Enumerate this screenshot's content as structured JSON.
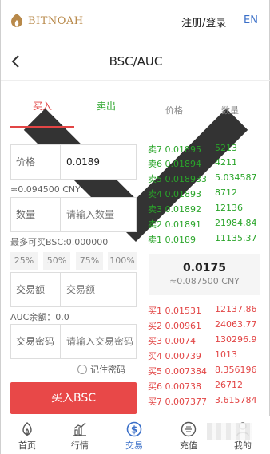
{
  "header": {
    "brand": "BITNOAH",
    "login": "注册/登录",
    "lang": "EN"
  },
  "titlebar": {
    "title": "BSC/AUC"
  },
  "tabs": {
    "buy": "买入",
    "sell": "卖出"
  },
  "form": {
    "price_label": "价格",
    "price_value": "0.0189",
    "price_cny": "≈0.094500 CNY",
    "qty_label": "数量",
    "qty_placeholder": "请输入数量",
    "max_buy": "最多可买BSC:0.000000",
    "percents": [
      "25%",
      "50%",
      "75%",
      "100%"
    ],
    "amount_label": "交易额",
    "amount_placeholder": "交易额",
    "balance": "AUC余额：0.0",
    "pwd_label": "交易密码",
    "pwd_placeholder": "请输入交易密码",
    "remember": "记住密码",
    "buy_button": "买入BSC"
  },
  "orderbook": {
    "head_price": "价格",
    "head_qty": "数量",
    "sells": [
      {
        "label": "卖7",
        "price": "0.01895",
        "qty": "5213"
      },
      {
        "label": "卖6",
        "price": "0.01894",
        "qty": "4211"
      },
      {
        "label": "卖5",
        "price": "0.018933",
        "qty": "5.034587"
      },
      {
        "label": "卖4",
        "price": "0.01893",
        "qty": "8712"
      },
      {
        "label": "卖3",
        "price": "0.01892",
        "qty": "12136"
      },
      {
        "label": "卖2",
        "price": "0.01891",
        "qty": "21984.84"
      },
      {
        "label": "卖1",
        "price": "0.0189",
        "qty": "11135.37"
      }
    ],
    "last_price": "0.0175",
    "last_cny": "≈0.087500 CNY",
    "buys": [
      {
        "label": "买1",
        "price": "0.01531",
        "qty": "12137.86"
      },
      {
        "label": "买2",
        "price": "0.00961",
        "qty": "24063.77"
      },
      {
        "label": "买3",
        "price": "0.0074",
        "qty": "130296.9"
      },
      {
        "label": "买4",
        "price": "0.00739",
        "qty": "1013"
      },
      {
        "label": "买5",
        "price": "0.007384",
        "qty": "8.356196"
      },
      {
        "label": "买6",
        "price": "0.00738",
        "qty": "26712"
      },
      {
        "label": "买7",
        "price": "0.007377",
        "qty": "3.615784"
      }
    ]
  },
  "bottomnav": {
    "items": [
      {
        "label": "首页",
        "icon": "home-icon"
      },
      {
        "label": "行情",
        "icon": "chart-icon"
      },
      {
        "label": "交易",
        "icon": "trade-icon"
      },
      {
        "label": "充值",
        "icon": "deposit-icon"
      },
      {
        "label": "我的",
        "icon": "user-icon"
      }
    ]
  },
  "colors": {
    "buy": "#e24545",
    "sell": "#2aa52a",
    "accent": "#3a6fc8",
    "brand": "#b8894a"
  }
}
